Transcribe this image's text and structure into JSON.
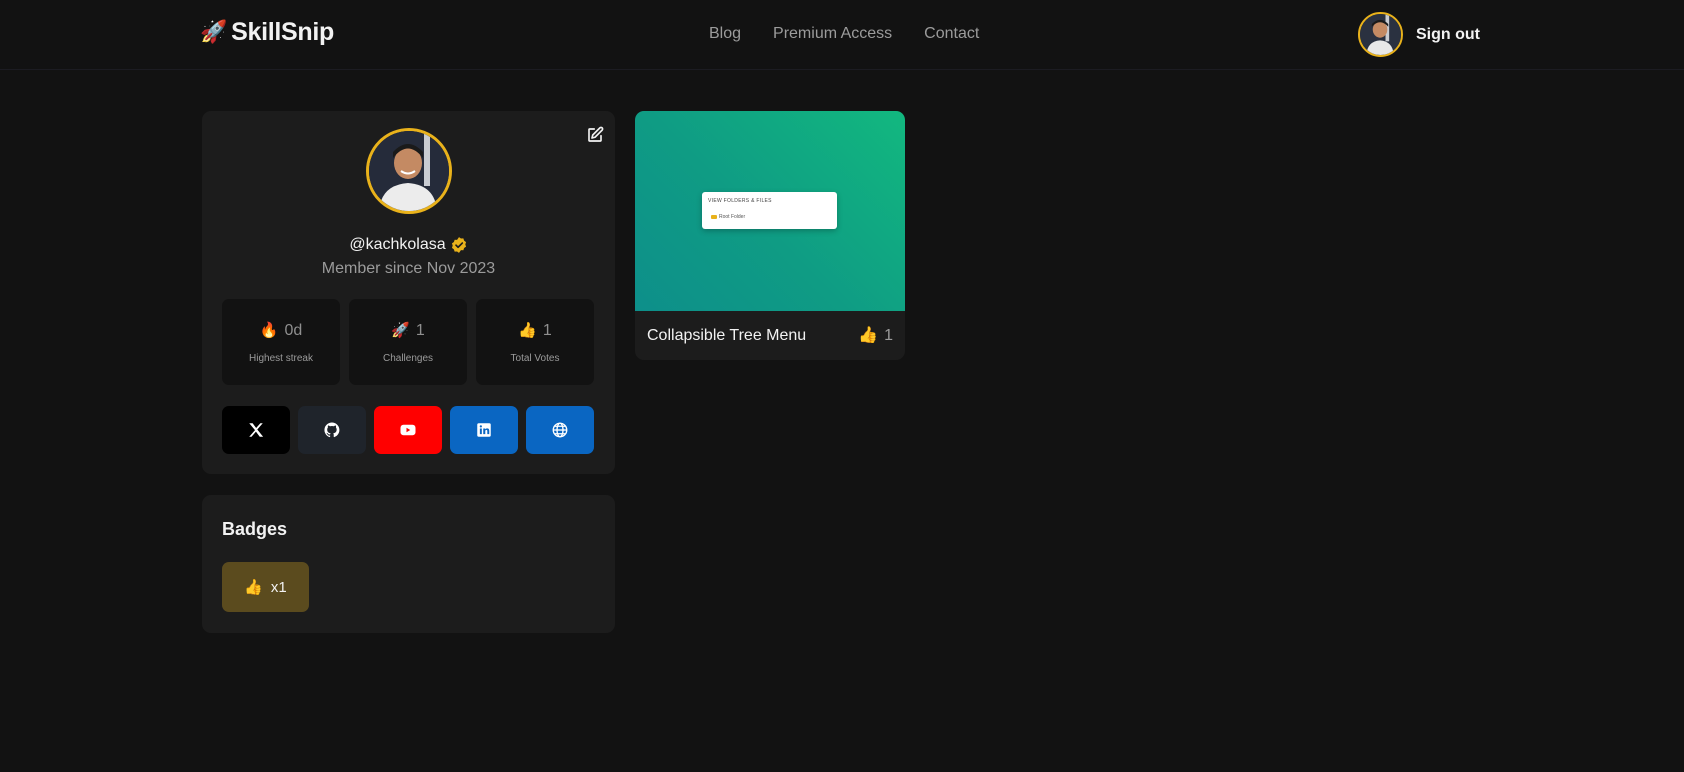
{
  "header": {
    "logo_emoji": "🚀",
    "logo_text": "SkillSnip",
    "nav": [
      "Blog",
      "Premium Access",
      "Contact"
    ],
    "signout_label": "Sign out"
  },
  "profile": {
    "username": "@kachkolasa",
    "member_since": "Member since Nov 2023",
    "stats": [
      {
        "emoji": "🔥",
        "value": "0d",
        "label": "Highest streak"
      },
      {
        "emoji": "🚀",
        "value": "1",
        "label": "Challenges"
      },
      {
        "emoji": "👍",
        "value": "1",
        "label": "Total Votes"
      }
    ],
    "socials": [
      {
        "name": "x-icon",
        "color": "#000000"
      },
      {
        "name": "github-icon",
        "color": "#1f242b"
      },
      {
        "name": "youtube-icon",
        "color": "#ff0000"
      },
      {
        "name": "linkedin-icon",
        "color": "#0a66c2"
      },
      {
        "name": "globe-icon",
        "color": "#0a66c2"
      }
    ]
  },
  "badges": {
    "title": "Badges",
    "items": [
      {
        "emoji": "👍",
        "count": "x1"
      }
    ]
  },
  "challenge": {
    "title": "Collapsible Tree Menu",
    "votes_emoji": "👍",
    "votes": "1",
    "preview": {
      "window_title": "VIEW FOLDERS & FILES",
      "item": "Root Folder"
    }
  },
  "colors": {
    "accent": "#e9b21b",
    "background": "#121212",
    "card": "#1c1c1c"
  }
}
